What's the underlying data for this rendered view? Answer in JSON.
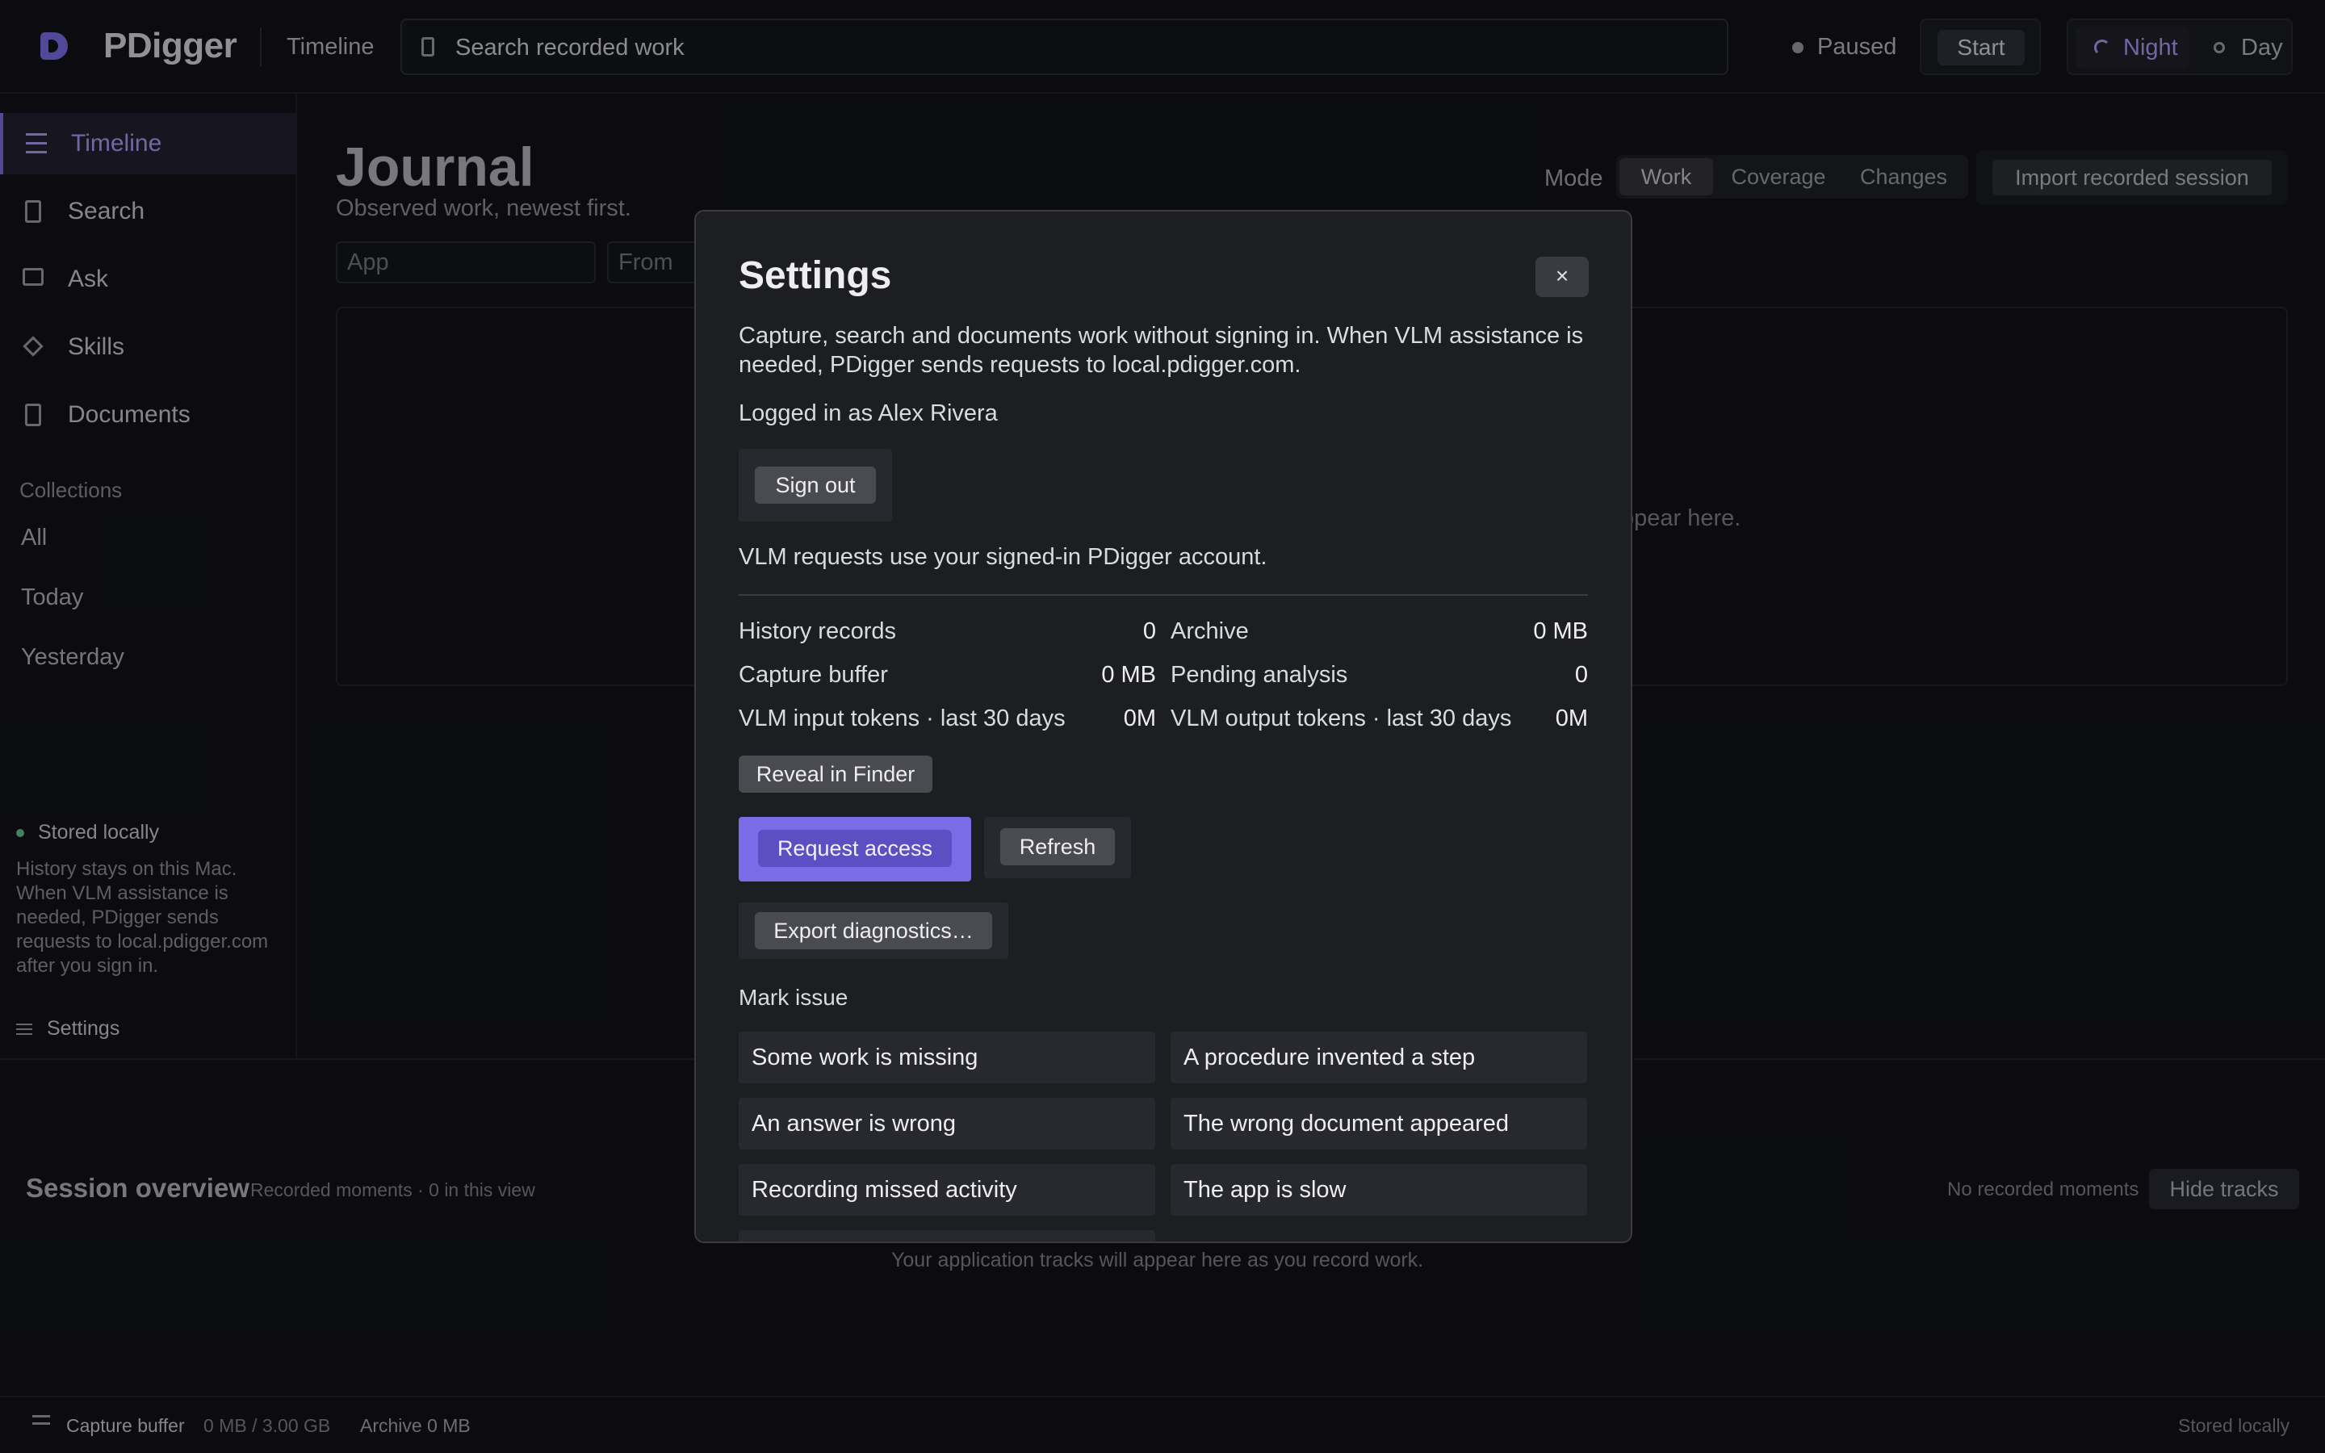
{
  "header": {
    "app_title": "PDigger",
    "nav_link": "Timeline",
    "search_placeholder": "Search recorded work",
    "status": "Paused",
    "start_label": "Start",
    "theme_night": "Night",
    "theme_day": "Day"
  },
  "sidebar": {
    "items": [
      {
        "label": "Timeline",
        "icon": "list-icon",
        "active": true
      },
      {
        "label": "Search",
        "icon": "document-icon"
      },
      {
        "label": "Ask",
        "icon": "terminal-icon"
      },
      {
        "label": "Skills",
        "icon": "diamond-icon"
      },
      {
        "label": "Documents",
        "icon": "document-icon"
      }
    ],
    "collections_heading": "Collections",
    "collections": [
      "All",
      "Today",
      "Yesterday"
    ],
    "stored_label": "Stored locally",
    "stored_desc": "History stays on this Mac. When VLM assistance is needed, PDigger sends requests to local.pdigger.com after you sign in.",
    "settings_label": "Settings"
  },
  "main": {
    "title": "Journal",
    "subtitle": "Observed work, newest first.",
    "mode_label": "Mode",
    "modes": [
      "Work",
      "Coverage",
      "Changes"
    ],
    "import_label": "Import recorded session",
    "filters": {
      "app_placeholder": "App",
      "from_placeholder": "From"
    },
    "empty_text": "ppear here."
  },
  "session": {
    "title": "Session overview",
    "subtitle": "Recorded moments · 0 in this view",
    "no_moments": "No recorded moments",
    "hide_tracks": "Hide tracks",
    "tracks_empty": "Your application tracks will appear here as you record work."
  },
  "footer": {
    "capture_label": "Capture buffer",
    "capture_value": "0 MB / 3.00 GB",
    "archive": "Archive 0 MB",
    "stored": "Stored locally"
  },
  "modal": {
    "title": "Settings",
    "close": "×",
    "description": "Capture, search and documents work without signing in. When VLM assistance is needed, PDigger sends requests to local.pdigger.com.",
    "logged_in": "Logged in as Alex Rivera",
    "sign_out": "Sign out",
    "vlm_note": "VLM requests use your signed-in PDigger account.",
    "stats": {
      "history_label": "History records",
      "history_value": "0",
      "archive_label": "Archive",
      "archive_value": "0 MB",
      "capture_label": "Capture buffer",
      "capture_value": "0 MB",
      "pending_label": "Pending analysis",
      "pending_value": "0",
      "vlm_in_label": "VLM input tokens · last 30 days",
      "vlm_in_value": "0M",
      "vlm_out_label": "VLM output tokens · last 30 days",
      "vlm_out_value": "0M"
    },
    "reveal": "Reveal in Finder",
    "request_access": "Request access",
    "refresh": "Refresh",
    "export": "Export diagnostics…",
    "mark_issue": "Mark issue",
    "issues": [
      "Some work is missing",
      "A procedure invented a step",
      "An answer is wrong",
      "The wrong document appeared",
      "Recording missed activity",
      "The app is slow"
    ]
  },
  "colors": {
    "accent": "#7a6be6",
    "background": "#0e0f13",
    "modal_bg": "#1d1e22"
  }
}
